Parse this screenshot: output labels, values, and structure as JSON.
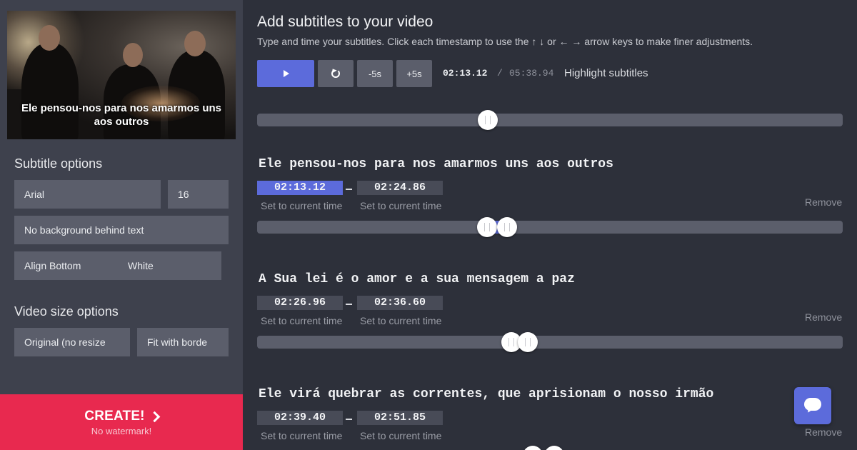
{
  "video": {
    "caption": "Ele pensou-nos para nos amarmos uns aos outros"
  },
  "sidebar": {
    "subtitle_options_heading": "Subtitle options",
    "font": "Arial",
    "font_size": "16",
    "background": "No background behind text",
    "align": "Align Bottom",
    "color": "White",
    "video_size_heading": "Video size options",
    "size_original": "Original (no resize",
    "size_fit": "Fit with borde"
  },
  "create": {
    "label": "CREATE!",
    "sub": "No watermark!"
  },
  "header": {
    "title": "Add subtitles to your video",
    "subtitle": "Type and time your subtitles. Click each timestamp to use the ↑ ↓ or ← → arrow keys to make finer adjustments."
  },
  "controls": {
    "play_icon": "play-icon",
    "replay_icon": "replay-icon",
    "minus5": "-5s",
    "plus5": "+5s",
    "current_time": "02:13.12",
    "separator": "/",
    "total_time": "05:38.94",
    "highlight_label": "Highlight subtitles",
    "playhead_fraction": 0.394
  },
  "subtitles": [
    {
      "text": "Ele pensou-nos para nos amarmos uns aos outros",
      "start": "02:13.12",
      "end": "02:24.86",
      "set_start": "Set to current time",
      "set_end": "Set to current time",
      "remove": "Remove"
    },
    {
      "text": "A Sua lei é o amor e a sua mensagem a paz",
      "start": "02:26.96",
      "end": "02:36.60",
      "set_start": "Set to current time",
      "set_end": "Set to current time",
      "remove": "Remove"
    },
    {
      "text": "Ele virá quebrar as correntes, que aprisionam o nosso irmão",
      "start": "02:39.40",
      "end": "02:51.85",
      "set_start": "Set to current time",
      "set_end": "Set to current time",
      "remove": "Remove"
    }
  ],
  "colors": {
    "accent": "#5c6bdb",
    "create": "#e8294f",
    "sidebar": "#3e414d",
    "main": "#2d303a"
  },
  "chat_icon": "chat-bubble-icon"
}
